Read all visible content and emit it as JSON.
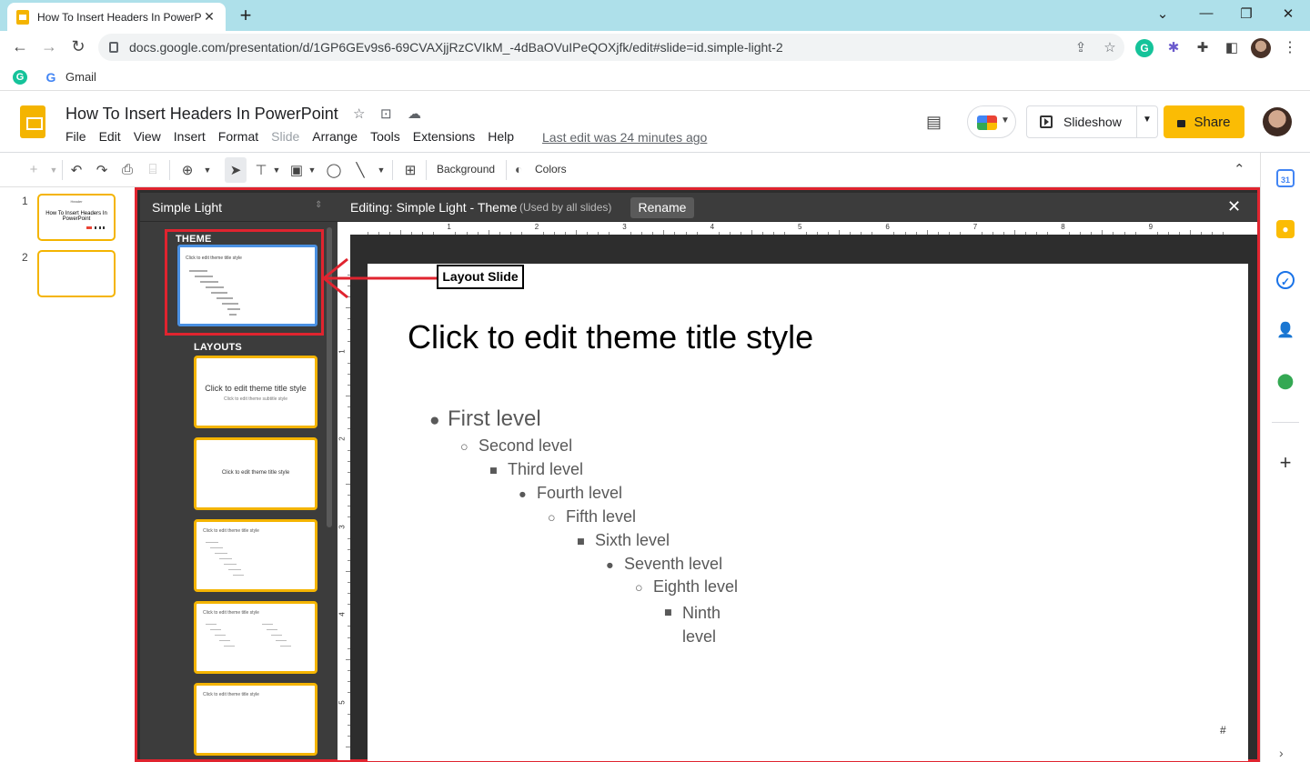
{
  "browser": {
    "tab_title": "How To Insert Headers In PowerP",
    "url": "docs.google.com/presentation/d/1GP6GEv9s6-69CVAXjjRzCVIkM_-4dBaOVuIPeQOXjfk/edit#slide=id.simple-light-2",
    "bookmarks": [
      {
        "label": "Gmail"
      }
    ]
  },
  "app": {
    "doc_title": "How To Insert Headers In PowerPoint",
    "menus": [
      "File",
      "Edit",
      "View",
      "Insert",
      "Format",
      "Slide",
      "Arrange",
      "Tools",
      "Extensions",
      "Help"
    ],
    "last_edit": "Last edit was 24 minutes ago",
    "slideshow_label": "Slideshow",
    "share_label": "Share"
  },
  "toolbar": {
    "background_label": "Background",
    "colors_label": "Colors"
  },
  "filmstrip": {
    "slides": [
      {
        "number": "1",
        "small_text": "Header",
        "title": "How To Insert Headers In PowerPoint"
      },
      {
        "number": "2"
      }
    ]
  },
  "theme_editor": {
    "theme_name": "Simple Light",
    "theme_section": "THEME",
    "layouts_section": "LAYOUTS",
    "editing_label": "Editing: Simple Light - Theme",
    "used_by": "(Used by all slides)",
    "rename_label": "Rename",
    "master_thumb_title": "Click to edit theme title style",
    "layouts": [
      {
        "title": "Click to edit theme title style",
        "subtitle": "Click to edit theme subtitle style"
      },
      {
        "title": "Click to edit theme title style"
      },
      {
        "title": "Click to edit theme title style"
      },
      {
        "title": "Click to edit theme title style"
      },
      {
        "title": "Click to edit theme title style"
      }
    ]
  },
  "ruler": {
    "h_labels": [
      "1",
      "2",
      "3",
      "4",
      "5",
      "6",
      "7",
      "8",
      "9"
    ],
    "v_labels": [
      "1",
      "2",
      "3",
      "4",
      "5"
    ]
  },
  "slide": {
    "title": "Click to edit theme title style",
    "levels": [
      "First level",
      "Second level",
      "Third level",
      "Fourth level",
      "Fifth level",
      "Sixth level",
      "Seventh level",
      "Eighth level",
      "Ninth level"
    ],
    "slide_number": "#"
  },
  "annotation": {
    "callout": "Layout Slide",
    "color": "#e0242f"
  }
}
